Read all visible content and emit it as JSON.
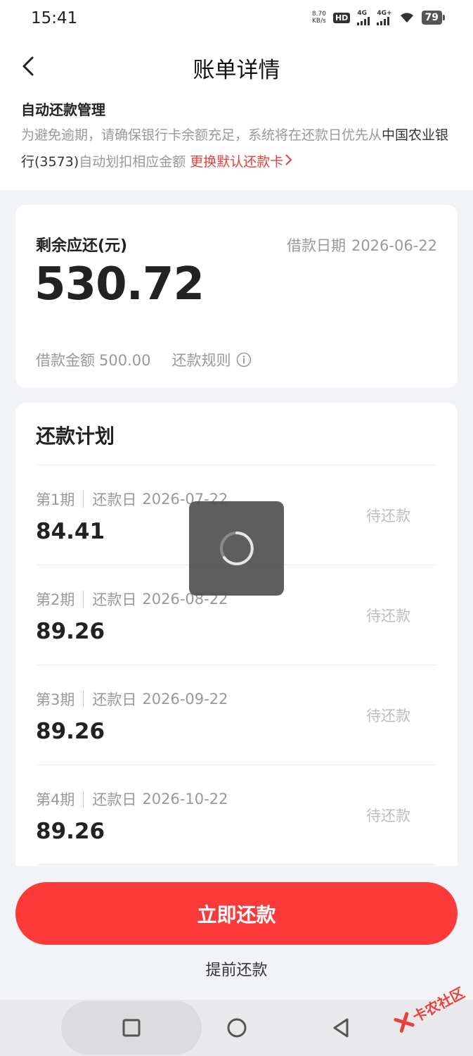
{
  "status_bar": {
    "time": "15:41",
    "net_speed_value": "8.70",
    "net_speed_unit": "KB/s",
    "hd_label": "HD",
    "sim1_label": "4G",
    "sim2_label": "4G+",
    "battery": "79"
  },
  "header": {
    "title": "账单详情"
  },
  "auto_repay": {
    "title": "自动还款管理",
    "text_part1": "为避免逾期，请确保银行卡余额充足，系统将在还款日优先从",
    "text_bank": "中国农业银行(3573)",
    "text_part2": "自动划扣相应金额",
    "link_label": "更换默认还款卡"
  },
  "summary": {
    "remaining_label": "剩余应还(元)",
    "remaining_amount": "530.72",
    "borrow_date_label": "借款日期",
    "borrow_date": "2026-06-22",
    "loan_amount_label": "借款金额",
    "loan_amount": "500.00",
    "rules_label": "还款规则"
  },
  "plan": {
    "title": "还款计划",
    "due_label": "还款日",
    "rows": [
      {
        "period": "第1期",
        "due_date": "2026-07-22",
        "amount": "84.41",
        "status": "待还款"
      },
      {
        "period": "第2期",
        "due_date": "2026-08-22",
        "amount": "89.26",
        "status": "待还款"
      },
      {
        "period": "第3期",
        "due_date": "2026-09-22",
        "amount": "89.26",
        "status": "待还款"
      },
      {
        "period": "第4期",
        "due_date": "2026-10-22",
        "amount": "89.26",
        "status": "待还款"
      }
    ]
  },
  "actions": {
    "pay_now": "立即还款",
    "prepay": "提前还款"
  },
  "watermark": {
    "text": "卡农社区"
  },
  "colors": {
    "accent": "#fd3a3a",
    "link": "#e8403a",
    "muted": "#999999",
    "status_pending": "#bdbdbd"
  }
}
